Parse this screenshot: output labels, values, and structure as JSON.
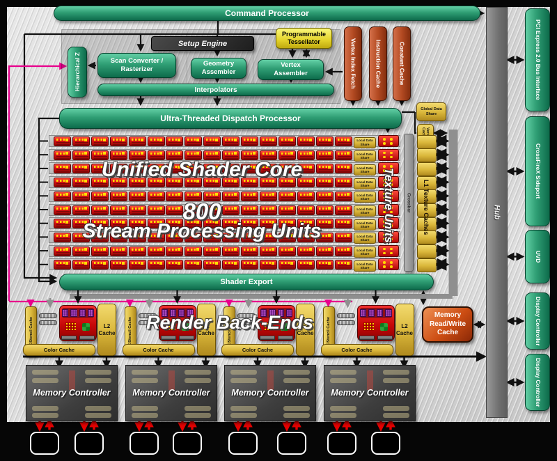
{
  "top": {
    "command_processor": "Command Processor",
    "setup_engine": "Setup Engine",
    "hierarchical_z": "Hierarchical Z",
    "scan_converter": "Scan Converter / Rasterizer",
    "geometry_assembler": "Geometry Assembler",
    "vertex_assembler": "Vertex Assembler",
    "interpolators": "Interpolators",
    "programmable_tessellator": "Programmable Tessellator",
    "vertex_index_fetch": "Vertex Index Fetch",
    "instruction_cache": "Instruction Cache",
    "constant_cache": "Constant Cache",
    "dispatch_processor": "Ultra-Threaded Dispatch Processor"
  },
  "shader_core": {
    "overlay_line1": "Unified Shader Core",
    "overlay_line2": "800",
    "overlay_line3": "Stream Processing Units",
    "rows": 10,
    "units_per_row": 16,
    "local_data_share": "Local Data Share",
    "texture_units": "Texture Units",
    "crossbar": "Crossbar",
    "l1_texture_caches": "L1 Texture Caches",
    "global_data_share": "Global Data Share",
    "vertex_cache": "Vertex Cache",
    "shader_export": "Shader Export"
  },
  "render_backends": {
    "overlay": "Render Back-Ends",
    "group_count": 4,
    "z_stencil_label": "Z/Stencil Cache",
    "color_label": "Color Cache",
    "l2_label": "L2 Cache"
  },
  "memory": {
    "rw_cache": "Memory Read/Write Cache",
    "controllers": [
      "Memory Controller",
      "Memory Controller",
      "Memory Controller",
      "Memory Controller"
    ],
    "chip_count": 8
  },
  "hub": "Hub",
  "right_panel": [
    "PCI Express 2.0 Bus Interface",
    "CrossFireX Sideport",
    "UVD",
    "Display Controller",
    "Display Controller"
  ],
  "colors": {
    "green": "#2f9e74",
    "gold": "#d9b63a",
    "unit_red": "#d01010",
    "cache_orange": "#b34a22",
    "pink": "#e8008c",
    "silver": "#d6d6d6"
  }
}
